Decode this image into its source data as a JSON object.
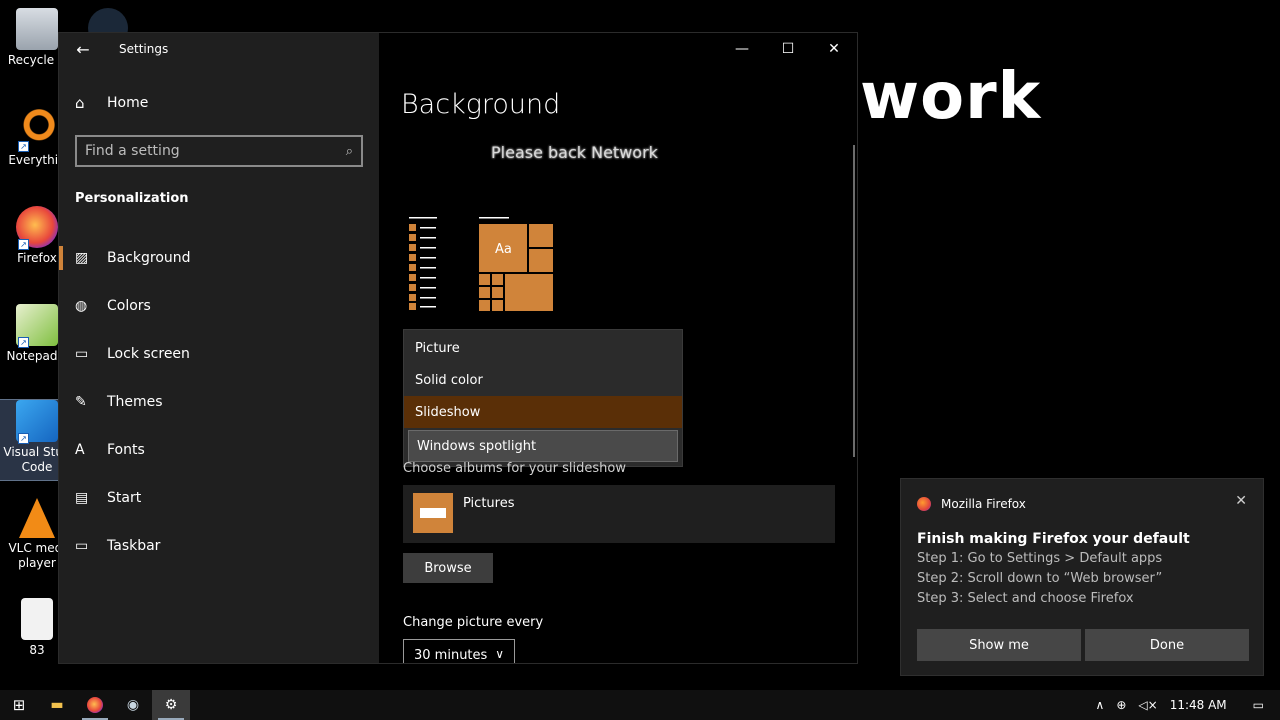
{
  "desktop": {
    "wallpaper_text": "work",
    "icons": [
      {
        "label": "Recycle B",
        "icon": "recycle-bin-icon"
      },
      {
        "label": "",
        "icon": "steam-icon"
      },
      {
        "label": "Everythin",
        "icon": "everything-search-icon"
      },
      {
        "label": "Firefox",
        "icon": "firefox-icon"
      },
      {
        "label": "Notepad+",
        "icon": "notepad-plus-icon"
      },
      {
        "label": "Visual Stud Code",
        "icon": "vscode-icon"
      },
      {
        "label": "VLC medi player",
        "icon": "vlc-icon"
      },
      {
        "label": "83",
        "icon": "document-icon"
      }
    ]
  },
  "settings": {
    "window_title": "Settings",
    "home_label": "Home",
    "search_placeholder": "Find a setting",
    "section_title": "Personalization",
    "nav": [
      {
        "label": "Background",
        "icon": "image-icon"
      },
      {
        "label": "Colors",
        "icon": "palette-icon"
      },
      {
        "label": "Lock screen",
        "icon": "lock-screen-icon"
      },
      {
        "label": "Themes",
        "icon": "themes-icon"
      },
      {
        "label": "Fonts",
        "icon": "fonts-icon"
      },
      {
        "label": "Start",
        "icon": "start-icon"
      },
      {
        "label": "Taskbar",
        "icon": "taskbar-icon"
      }
    ],
    "page_title": "Background",
    "preview_text": "Please back Network",
    "preview_tile_text": "Aa",
    "dropdown_options": [
      "Picture",
      "Solid color",
      "Slideshow",
      "Windows spotlight"
    ],
    "dropdown_selected": "Slideshow",
    "albums_label": "Choose albums for your slideshow",
    "album_name": "Pictures",
    "browse_label": "Browse",
    "change_label": "Change picture every",
    "interval_value": "30 minutes"
  },
  "toast": {
    "app_name": "Mozilla Firefox",
    "title": "Finish making Firefox your default",
    "lines": [
      "Step 1: Go to Settings > Default apps",
      "Step 2: Scroll down to “Web browser”",
      "Step 3: Select and choose Firefox"
    ],
    "show_me_label": "Show me",
    "done_label": "Done"
  },
  "taskbar": {
    "time": "11:48 AM"
  },
  "colors": {
    "accent": "#d0843a",
    "selected_option": "#5a2f07"
  }
}
